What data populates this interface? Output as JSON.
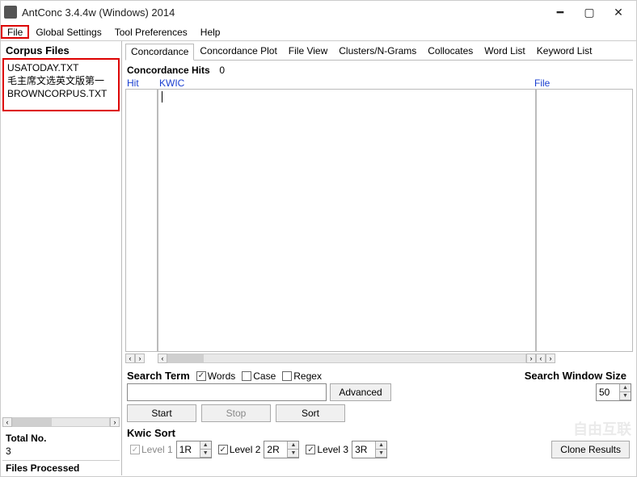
{
  "window": {
    "title": "AntConc 3.4.4w (Windows) 2014"
  },
  "menubar": {
    "file": "File",
    "global": "Global Settings",
    "tool": "Tool Preferences",
    "help": "Help"
  },
  "sidebar": {
    "heading": "Corpus Files",
    "files": [
      "USATODAY.TXT",
      "毛主席文选英文版第一",
      "BROWNCORPUS.TXT"
    ],
    "total_lbl": "Total No.",
    "total_val": "3",
    "files_processed_lbl": "Files Processed"
  },
  "tabs": {
    "items": [
      "Concordance",
      "Concordance Plot",
      "File View",
      "Clusters/N-Grams",
      "Collocates",
      "Word List",
      "Keyword List"
    ],
    "active_index": 0
  },
  "hits": {
    "label": "Concordance Hits",
    "value": "0"
  },
  "headers": {
    "hit": "Hit",
    "kwic": "KWIC",
    "file": "File"
  },
  "search": {
    "term_lbl": "Search Term",
    "words_lbl": "Words",
    "case_lbl": "Case",
    "regex_lbl": "Regex",
    "words_checked": true,
    "case_checked": false,
    "regex_checked": false,
    "advanced_btn": "Advanced",
    "window_lbl": "Search Window Size",
    "window_val": "50",
    "input_value": ""
  },
  "buttons": {
    "start": "Start",
    "stop": "Stop",
    "sort": "Sort"
  },
  "kwicsort": {
    "label": "Kwic Sort",
    "lvl1_lbl": "Level 1",
    "lvl1_val": "1R",
    "lvl2_lbl": "Level 2",
    "lvl2_val": "2R",
    "lvl3_lbl": "Level 3",
    "lvl3_val": "3R"
  },
  "clone_btn": "Clone Results",
  "watermark": "自由互联"
}
